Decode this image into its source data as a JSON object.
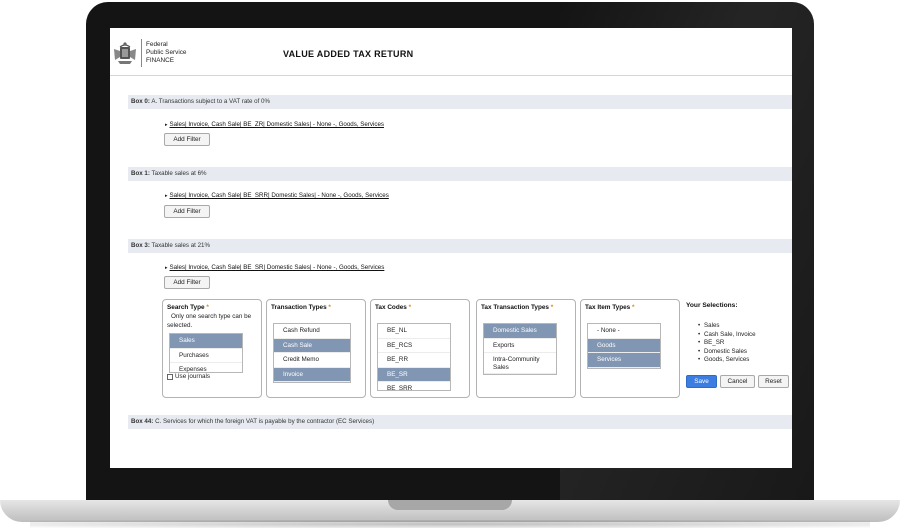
{
  "header": {
    "org_name": [
      "Federal",
      "Public Service",
      "FINANCE"
    ],
    "title": "VALUE ADDED TAX RETURN"
  },
  "boxes": [
    {
      "label": "Box 0:",
      "description": "A. Transactions subject to a VAT rate of 0%",
      "filter": "Sales| Invoice, Cash Sale| BE_ZR| Domestic Sales| - None -, Goods, Services"
    },
    {
      "label": "Box 1:",
      "description": "Taxable sales at 6%",
      "filter": "Sales| Invoice, Cash Sale| BE_SRR| Domestic Sales| - None -, Goods, Services"
    },
    {
      "label": "Box 3:",
      "description": "Taxable sales at 21%",
      "filter": "Sales| Invoice, Cash Sale| BE_SR| Domestic Sales| - None -, Goods, Services"
    },
    {
      "label": "Box 44:",
      "description": "C. Services for which the foreign VAT is payable by the contractor (EC Services)"
    }
  ],
  "add_filter_label": "Add Filter",
  "required_marker": "*",
  "panels": {
    "search_type": {
      "title": "Search Type",
      "note": "Only one search type can be selected.",
      "options": [
        {
          "label": "Sales",
          "selected": true
        },
        {
          "label": "Purchases",
          "selected": false
        },
        {
          "label": "Expenses",
          "selected": false
        }
      ],
      "use_journals_label": "Use journals"
    },
    "transaction_types": {
      "title": "Transaction Types",
      "options": [
        {
          "label": "Cash Refund",
          "selected": false
        },
        {
          "label": "Cash Sale",
          "selected": true
        },
        {
          "label": "Credit Memo",
          "selected": false
        },
        {
          "label": "Invoice",
          "selected": true
        }
      ]
    },
    "tax_codes": {
      "title": "Tax Codes",
      "options": [
        {
          "label": "BE_NL",
          "selected": false
        },
        {
          "label": "BE_RCS",
          "selected": false
        },
        {
          "label": "BE_RR",
          "selected": false
        },
        {
          "label": "BE_SR",
          "selected": true
        },
        {
          "label": "BE_SRR",
          "selected": false
        }
      ]
    },
    "tax_transaction_types": {
      "title": "Tax Transaction Types",
      "options": [
        {
          "label": "Domestic Sales",
          "selected": true
        },
        {
          "label": "Exports",
          "selected": false
        },
        {
          "label": "Intra-Community Sales",
          "selected": false
        }
      ]
    },
    "tax_item_types": {
      "title": "Tax Item Types",
      "options": [
        {
          "label": "- None -",
          "selected": false
        },
        {
          "label": "Goods",
          "selected": true
        },
        {
          "label": "Services",
          "selected": true
        }
      ]
    }
  },
  "selections": {
    "title": "Your Selections:",
    "items": [
      "Sales",
      "Cash Sale, Invoice",
      "BE_SR",
      "Domestic Sales",
      "Goods, Services"
    ]
  },
  "actions": {
    "save": "Save",
    "cancel": "Cancel",
    "reset": "Reset"
  },
  "colors": {
    "selected_option": "#8196b3",
    "box_header_bg": "#e7ebf1",
    "save_button": "#3b7de0",
    "required": "#e08a00"
  }
}
